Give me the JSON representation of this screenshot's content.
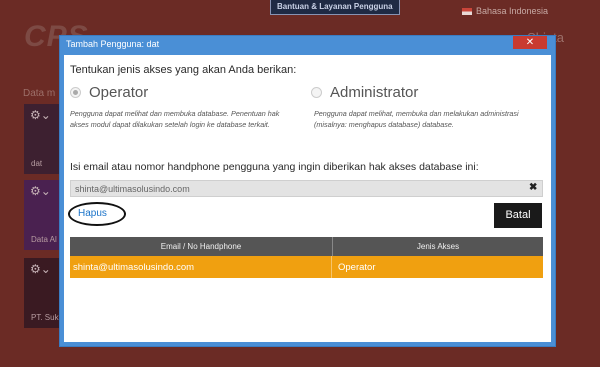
{
  "background": {
    "help_link": "Bantuan & Layanan Pengguna",
    "language": "Bahasa Indonesia",
    "logo": "CPS",
    "user_name": "Shinta",
    "data_label": "Data m",
    "cards": [
      "dat",
      "Data Al",
      "PT. Suk"
    ]
  },
  "dialog": {
    "title": "Tambah Pengguna: dat",
    "close_symbol": "✕",
    "access_prompt": "Tentukan jenis akses yang akan Anda berikan:",
    "options": [
      {
        "label": "Operator",
        "selected": true,
        "description": "Pengguna dapat melihat dan membuka database. Penentuan hak akses modul dapat dilakukan setelah login ke database terkait."
      },
      {
        "label": "Administrator",
        "selected": false,
        "description": "Pengguna dapat melihat, membuka dan melakukan administrasi (misalnya: menghapus database) database."
      }
    ],
    "email_prompt": "Isi email atau nomor handphone pengguna yang ingin diberikan hak akses database ini:",
    "email_value": "shinta@ultimasolusindo.com",
    "clear_symbol": "✖",
    "remove_label": "Hapus",
    "cancel_label": "Batal",
    "table": {
      "headers": [
        "Email / No Handphone",
        "Jenis Akses"
      ],
      "rows": [
        [
          "shinta@ultimasolusindo.com",
          "Operator"
        ]
      ]
    }
  },
  "colors": {
    "titlebar": "#4a8fd6",
    "close": "#c93a30",
    "row_highlight": "#f0a010",
    "table_header": "#555555"
  }
}
